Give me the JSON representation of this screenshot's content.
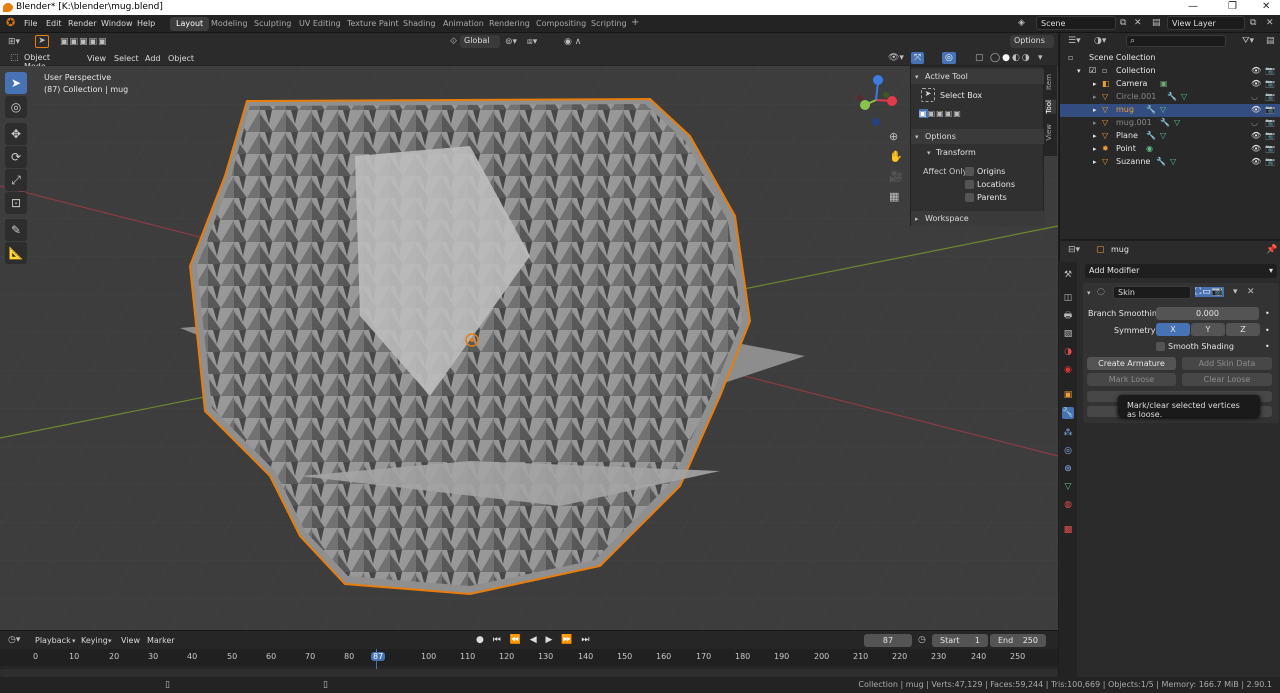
{
  "window": {
    "title": "Blender* [K:\\blender\\mug.blend]",
    "min": "—",
    "max": "❐",
    "close": "✕"
  },
  "menu": [
    "File",
    "Edit",
    "Render",
    "Window",
    "Help"
  ],
  "workspaces": [
    "Layout",
    "Modeling",
    "Sculpting",
    "UV Editing",
    "Texture Paint",
    "Shading",
    "Animation",
    "Rendering",
    "Compositing",
    "Scripting"
  ],
  "scene_label": "Scene",
  "view_layer_label": "View Layer",
  "viewport_header": {
    "transform_orient": "Global",
    "options": "Options",
    "mode": "Object Mode",
    "menus": [
      "View",
      "Select",
      "Add",
      "Object"
    ]
  },
  "viewport_info": {
    "line1": "User Perspective",
    "line2": "(87) Collection | mug"
  },
  "npanel": {
    "active_tool": "Active Tool",
    "select_box": "Select Box",
    "options": "Options",
    "transform": "Transform",
    "affect_only": "Affect Only",
    "origins": "Origins",
    "locations": "Locations",
    "parents": "Parents",
    "workspace": "Workspace",
    "tabs": [
      "Item",
      "Tool",
      "View"
    ]
  },
  "outliner": {
    "search_placeholder": "",
    "root": "Scene Collection",
    "items": [
      {
        "name": "Collection",
        "indent": 0
      },
      {
        "name": "Camera",
        "indent": 1
      },
      {
        "name": "Circle.001",
        "indent": 1,
        "dim": true
      },
      {
        "name": "mug",
        "indent": 1,
        "selected": true
      },
      {
        "name": "mug.001",
        "indent": 1,
        "dim": true
      },
      {
        "name": "Plane",
        "indent": 1
      },
      {
        "name": "Point",
        "indent": 1
      },
      {
        "name": "Suzanne",
        "indent": 1
      }
    ]
  },
  "properties": {
    "object": "mug",
    "add_modifier": "Add Modifier",
    "modifier_name": "Skin",
    "branch_label": "Branch Smoothing",
    "branch_value": "0.000",
    "symmetry_label": "Symmetry",
    "sym": [
      "X",
      "Y",
      "Z"
    ],
    "smooth_shading": "Smooth Shading",
    "create_armature": "Create Armature",
    "add_skin_data": "Add Skin Data",
    "mark_loose": "Mark Loose",
    "clear_loose": "Clear Loose",
    "tooltip": "Mark/clear selected vertices as loose."
  },
  "timeline": {
    "menus": [
      "Playback",
      "Keying",
      "View",
      "Marker"
    ],
    "current": "87",
    "start_label": "Start",
    "start": "1",
    "end_label": "End",
    "end": "250",
    "ticks": [
      "0",
      "10",
      "20",
      "30",
      "40",
      "50",
      "60",
      "70",
      "80",
      "87",
      "100",
      "110",
      "120",
      "130",
      "140",
      "150",
      "160",
      "170",
      "180",
      "190",
      "200",
      "210",
      "220",
      "230",
      "240",
      "250"
    ]
  },
  "status": "Collection | mug | Verts:47,129 | Faces:59,244 | Tris:100,669 | Objects:1/5 | Memory: 166.7 MiB | 2.90.1",
  "colors": {
    "accent": "#4772b3",
    "selection": "#e87d0d",
    "viewport": "#3d3d3d"
  }
}
